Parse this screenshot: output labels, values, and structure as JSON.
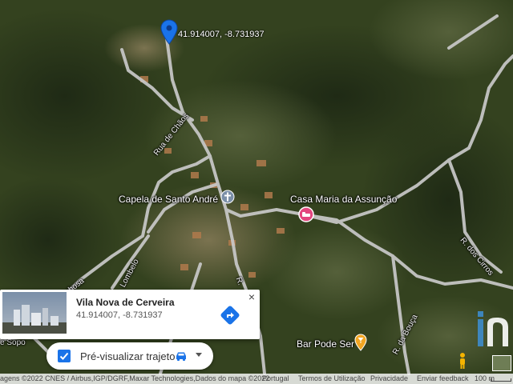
{
  "pin": {
    "coordinates": "41.914007, -8.731937"
  },
  "places": {
    "church": "Capela de Santo André",
    "guesthouse": "Casa Maria da Assunção",
    "bar": "Bar Pode Ser"
  },
  "roads": {
    "rua_chaos": "Rua de Chãos",
    "r_cirros": "R. dos Cirros",
    "r_bouca": "R. da Bouça",
    "lombelo": "Lombelo",
    "pinhosa": "Pinhosa",
    "sopo": "e Sopo",
    "rua_short": "R."
  },
  "info_card": {
    "title": "Vila Nova de Cerveira",
    "coords": "41.914007, -8.731937",
    "close_icon": "close-icon",
    "directions_icon": "directions-icon"
  },
  "preview_bar": {
    "label": "Pré-visualizar trajeto",
    "checked": true
  },
  "footer": {
    "attribution": "agens ©2022 CNES / Airbus,IGP/DGRF,Maxar Technologies,Dados do mapa ©2022",
    "country": "Portugal",
    "terms": "Termos de Utilização",
    "privacy": "Privacidade",
    "feedback": "Enviar feedback",
    "scale": "100 m"
  },
  "colors": {
    "pin": "#1a73e8",
    "hotel_marker": "#e3467f",
    "bar_marker": "#f2a622",
    "road": "#c9c9c9"
  }
}
